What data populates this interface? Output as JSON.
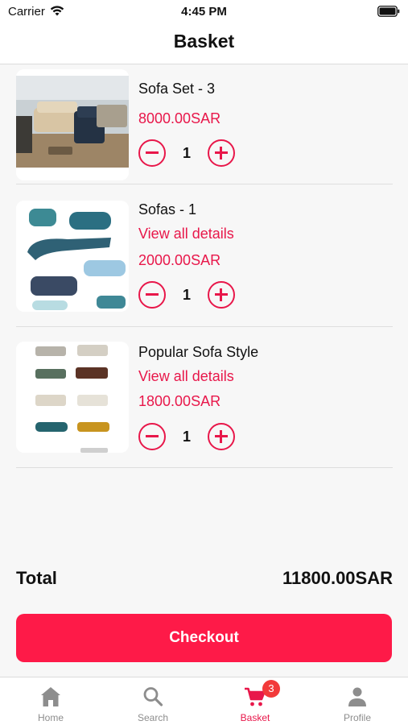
{
  "status_bar": {
    "carrier": "Carrier",
    "time": "4:45 PM",
    "icons": [
      "wifi-icon",
      "battery-icon"
    ]
  },
  "header": {
    "title": "Basket"
  },
  "basket": {
    "items": [
      {
        "name": "Sofa Set - 3",
        "details_link": "",
        "price": "8000.00SAR",
        "quantity": "1"
      },
      {
        "name": "Sofas - 1",
        "details_link": "View all details",
        "price": "2000.00SAR",
        "quantity": "1"
      },
      {
        "name": "Popular Sofa Style",
        "details_link": "View all details",
        "price": "1800.00SAR",
        "quantity": "1"
      }
    ],
    "total_label": "Total",
    "total_value": "11800.00SAR",
    "checkout_label": "Checkout"
  },
  "tab_bar": {
    "tabs": [
      {
        "label": "Home",
        "icon": "home-icon",
        "active": false
      },
      {
        "label": "Search",
        "icon": "search-icon",
        "active": false
      },
      {
        "label": "Basket",
        "icon": "cart-icon",
        "active": true,
        "badge": "3"
      },
      {
        "label": "Profile",
        "icon": "person-icon",
        "active": false
      }
    ]
  },
  "colors": {
    "accent": "#e8174a",
    "checkout_button": "#fe1a48",
    "badge": "#f23a3a",
    "inactive_tab": "#8d8d8d"
  }
}
